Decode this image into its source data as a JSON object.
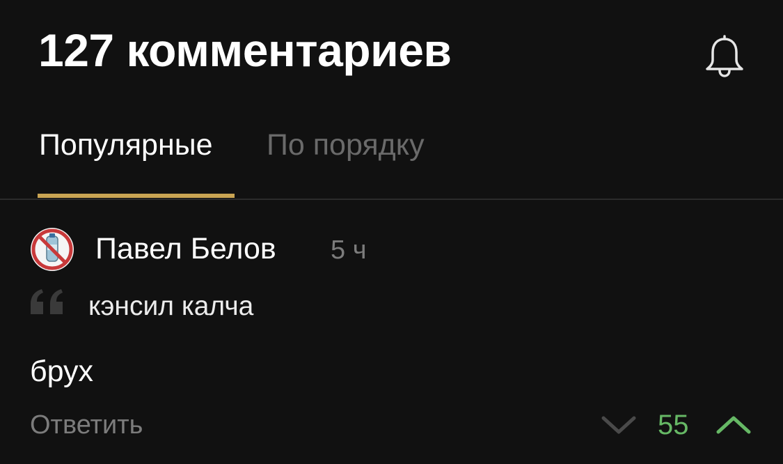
{
  "header": {
    "title": "127 комментариев",
    "bell_icon": "bell-icon"
  },
  "tabs": [
    {
      "label": "Популярные",
      "active": true
    },
    {
      "label": "По порядку",
      "active": false
    }
  ],
  "colors": {
    "background": "#111111",
    "accent_underline": "#c9a453",
    "upvote_green": "#66b865",
    "muted_text": "#7c7c7c"
  },
  "comment": {
    "avatar_icon": "no-plastic-bottle-sign-icon",
    "author": "Павел Белов",
    "time": "5 ч",
    "quote": "кэнсил калча",
    "text": "брух",
    "reply_label": "Ответить",
    "score": "55",
    "downvote_icon": "chevron-down-icon",
    "upvote_icon": "chevron-up-icon"
  }
}
